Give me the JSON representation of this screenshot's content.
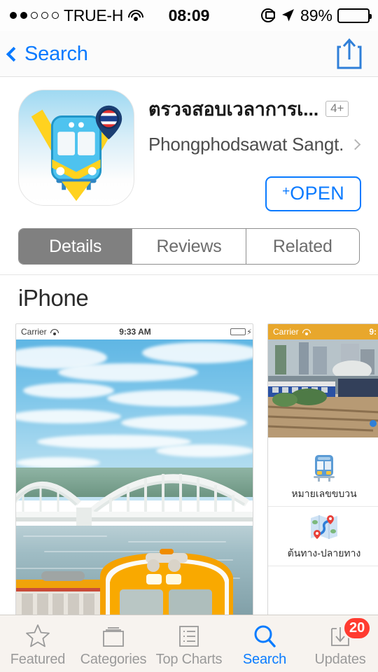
{
  "status_bar": {
    "signal_dots_filled": 2,
    "signal_dots_total": 5,
    "carrier": "TRUE-H",
    "wifi_icon": "wifi-icon",
    "time": "08:09",
    "rotation_lock_icon": "rotation-lock-icon",
    "location_icon": "location-arrow-icon",
    "battery_percent": "89%",
    "battery_level": 89
  },
  "nav_bar": {
    "back_label": "Search",
    "back_icon": "chevron-left-icon",
    "share_icon": "share-icon"
  },
  "app": {
    "icon_name": "train-app-icon",
    "title": "ตรวจสอบเวลาการเ...",
    "age_rating": "4+",
    "developer": "Phongphodsawat Sangt...",
    "developer_chevron_icon": "chevron-right-icon",
    "open_button_label": "OPEN",
    "open_button_plus": "+",
    "accent_color": "#097aff"
  },
  "segmented_control": {
    "selected_index": 0,
    "items": [
      {
        "label": "Details"
      },
      {
        "label": "Reviews"
      },
      {
        "label": "Related"
      }
    ]
  },
  "screenshots_section": {
    "heading": "iPhone",
    "shots": [
      {
        "name": "bridge-and-train-screenshot",
        "status_bar": {
          "carrier": "Carrier",
          "wifi_icon": "wifi-icon",
          "time": "9:33 AM",
          "battery_icon": "battery-charging-icon"
        },
        "content_description": "White arch railway bridge over river with orange and white locomotive"
      },
      {
        "name": "train-menu-screenshot",
        "status_bar": {
          "carrier": "Carrier",
          "wifi_icon": "wifi-icon",
          "time": "9:"
        },
        "nav_bar_color": "#e8a72c",
        "menu_items": [
          {
            "icon": "train-front-icon",
            "label": "หมายเลขขบวน"
          },
          {
            "icon": "map-route-icon",
            "label": "ต้นทาง-ปลายทาง"
          }
        ]
      }
    ]
  },
  "tab_bar": {
    "selected": "Search",
    "tabs": [
      {
        "label": "Featured",
        "icon": "star-icon"
      },
      {
        "label": "Categories",
        "icon": "folder-icon"
      },
      {
        "label": "Top Charts",
        "icon": "list-icon"
      },
      {
        "label": "Search",
        "icon": "magnifier-icon"
      },
      {
        "label": "Updates",
        "icon": "download-icon",
        "badge": "20"
      }
    ]
  }
}
